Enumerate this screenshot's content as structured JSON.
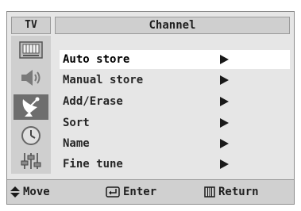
{
  "header": {
    "tv_label": "TV",
    "title": "Channel"
  },
  "sidebar": {
    "icons": [
      "picture-icon",
      "sound-icon",
      "channel-icon",
      "clock-icon",
      "setup-icon"
    ],
    "active_index": 2
  },
  "menu": {
    "items": [
      {
        "label": "Auto store",
        "selected": true
      },
      {
        "label": "Manual store",
        "selected": false
      },
      {
        "label": "Add/Erase",
        "selected": false
      },
      {
        "label": "Sort",
        "selected": false
      },
      {
        "label": "Name",
        "selected": false
      },
      {
        "label": "Fine tune",
        "selected": false
      }
    ]
  },
  "footer": {
    "move": "Move",
    "enter": "Enter",
    "return": "Return"
  }
}
